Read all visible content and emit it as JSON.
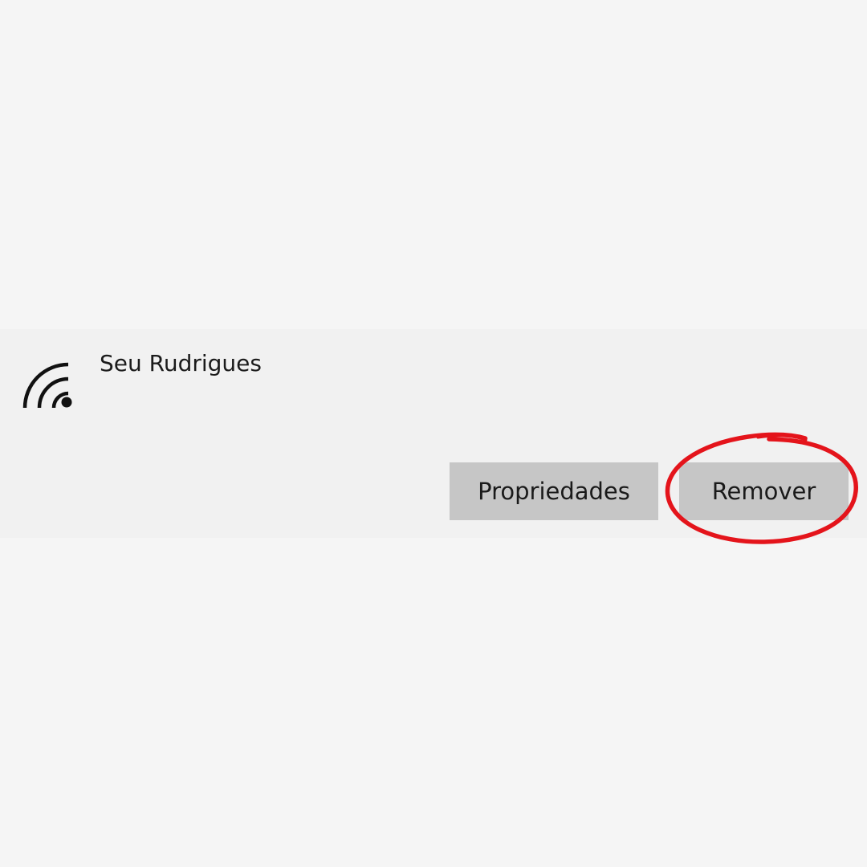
{
  "network": {
    "icon": "wifi-signal-icon",
    "name": "Seu Rudrigues"
  },
  "actions": {
    "properties_label": "Propriedades",
    "remove_label": "Remover"
  },
  "annotation": {
    "icon": "red-highlight-circle",
    "color": "#e4141b"
  },
  "colors": {
    "page_background": "#f5f5f5",
    "card_background": "#f1f1f1",
    "button_background": "#c6c6c6",
    "text": "#1b1b1b"
  }
}
